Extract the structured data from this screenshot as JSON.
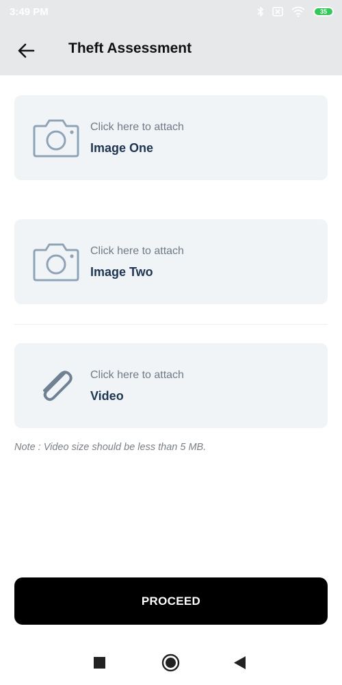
{
  "status_bar": {
    "time": "3:49 PM",
    "battery_level": "35"
  },
  "header": {
    "title": "Theft Assessment"
  },
  "attachments": [
    {
      "hint": "Click here to attach",
      "label": "Image One",
      "icon": "camera-icon"
    },
    {
      "hint": "Click here to attach",
      "label": "Image Two",
      "icon": "camera-icon"
    },
    {
      "hint": "Click here to attach",
      "label": "Video",
      "icon": "paperclip-icon"
    }
  ],
  "note": "Note : Video size should be less than 5 MB.",
  "proceed_label": "PROCEED",
  "colors": {
    "app_bar_bg": "#e6e8ea",
    "card_bg": "#f1f4f7",
    "icon_color": "#8fa3b6",
    "label_color": "#1e3552",
    "button_bg": "#000000"
  },
  "nav": {
    "recents": "square-icon",
    "home": "circle-icon",
    "back": "triangle-icon"
  }
}
